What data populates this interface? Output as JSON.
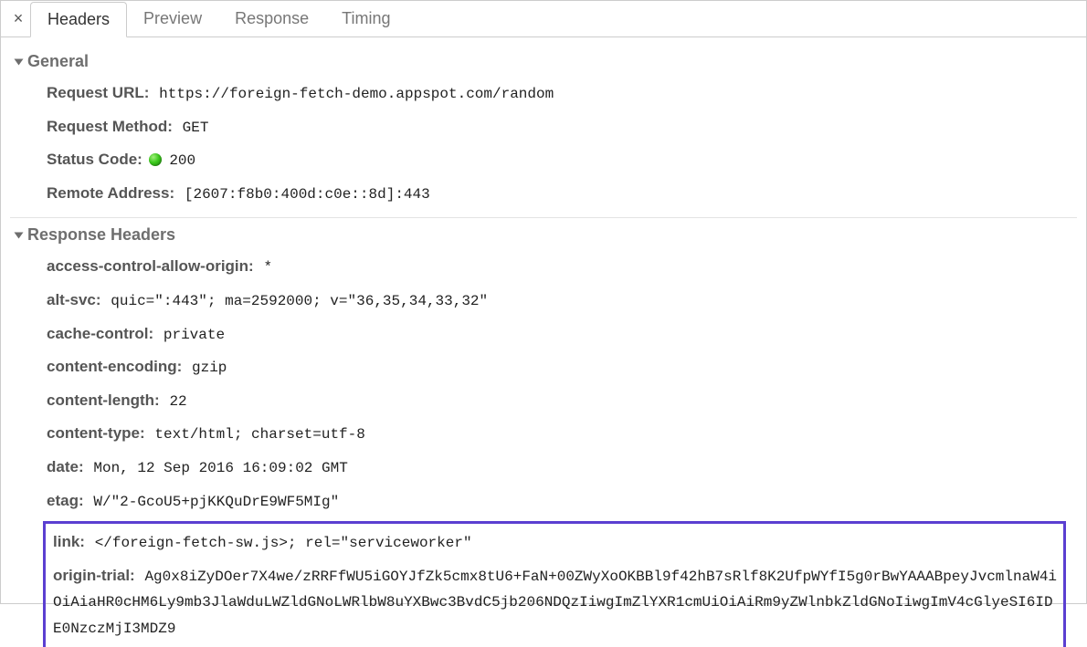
{
  "tabs": {
    "close": "×",
    "items": [
      "Headers",
      "Preview",
      "Response",
      "Timing"
    ],
    "active": 0
  },
  "sections": {
    "general": {
      "title": "General",
      "request_url_label": "Request URL:",
      "request_url": "https://foreign-fetch-demo.appspot.com/random",
      "request_method_label": "Request Method:",
      "request_method": "GET",
      "status_code_label": "Status Code:",
      "status_code": "200",
      "remote_address_label": "Remote Address:",
      "remote_address": "[2607:f8b0:400d:c0e::8d]:443"
    },
    "response": {
      "title": "Response Headers",
      "acao_label": "access-control-allow-origin:",
      "acao": "*",
      "altsvc_label": "alt-svc:",
      "altsvc": "quic=\":443\"; ma=2592000; v=\"36,35,34,33,32\"",
      "cache_label": "cache-control:",
      "cache": "private",
      "enc_label": "content-encoding:",
      "enc": "gzip",
      "len_label": "content-length:",
      "len": "22",
      "ctype_label": "content-type:",
      "ctype": "text/html; charset=utf-8",
      "date_label": "date:",
      "date": "Mon, 12 Sep 2016 16:09:02 GMT",
      "etag_label": "etag:",
      "etag": "W/\"2-GcoU5+pjKKQuDrE9WF5MIg\"",
      "link_label": "link:",
      "link": "</foreign-fetch-sw.js>; rel=\"serviceworker\"",
      "ot_label": "origin-trial:",
      "ot": "Ag0x8iZyDOer7X4we/zRRFfWU5iGOYJfZk5cmx8tU6+FaN+00ZWyXoOKBBl9f42hB7sRlf8K2UfpWYfI5g0rBwYAAABpeyJvcmlnaW4iOiAiaHR0cHM6Ly9mb3JlaWduLWZldGNoLWRlbW8uYXBwc3BvdC5jb206NDQzIiwgImZlYXR1cmUiOiAiRm9yZWlnbkZldGNoIiwgImV4cGlyeSI6IDE0NzczMjI3MDZ9"
    }
  }
}
